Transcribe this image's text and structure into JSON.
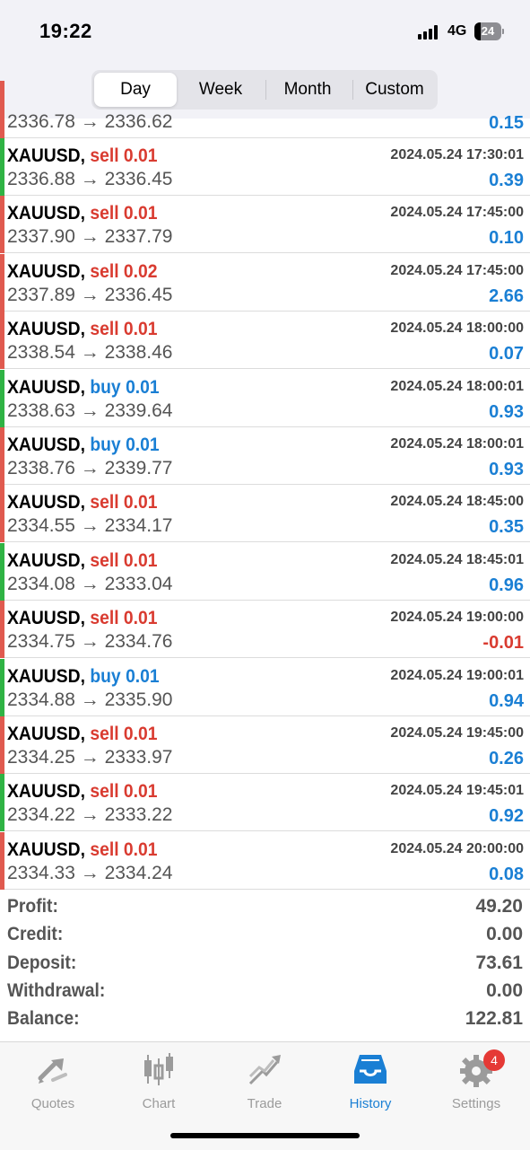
{
  "status_bar": {
    "time": "19:22",
    "network": "4G",
    "battery": "24"
  },
  "period_tabs": [
    {
      "label": "Day",
      "active": true
    },
    {
      "label": "Week",
      "active": false
    },
    {
      "label": "Month",
      "active": false
    },
    {
      "label": "Custom",
      "active": false
    }
  ],
  "colors": {
    "buy": "#1a7fd4",
    "sell": "#d93b30",
    "profit": "#1a7fd4",
    "loss": "#d93b30",
    "bar_green": "#2fb344",
    "bar_red": "#e05a4f"
  },
  "partial_row": {
    "prices": "2336.78 → 2336.62",
    "profit": "0.15"
  },
  "deals": [
    {
      "symbol": "XAUUSD,",
      "side": "sell",
      "lot": "0.01",
      "time": "2024.05.24 17:30:01",
      "prices": "2336.88 → 2336.45",
      "profit": "0.39",
      "bar": "green"
    },
    {
      "symbol": "XAUUSD,",
      "side": "sell",
      "lot": "0.01",
      "time": "2024.05.24 17:45:00",
      "prices": "2337.90 → 2337.79",
      "profit": "0.10",
      "bar": "red"
    },
    {
      "symbol": "XAUUSD,",
      "side": "sell",
      "lot": "0.02",
      "time": "2024.05.24 17:45:00",
      "prices": "2337.89 → 2336.45",
      "profit": "2.66",
      "bar": "red"
    },
    {
      "symbol": "XAUUSD,",
      "side": "sell",
      "lot": "0.01",
      "time": "2024.05.24 18:00:00",
      "prices": "2338.54 → 2338.46",
      "profit": "0.07",
      "bar": "red"
    },
    {
      "symbol": "XAUUSD,",
      "side": "buy",
      "lot": "0.01",
      "time": "2024.05.24 18:00:01",
      "prices": "2338.63 → 2339.64",
      "profit": "0.93",
      "bar": "green"
    },
    {
      "symbol": "XAUUSD,",
      "side": "buy",
      "lot": "0.01",
      "time": "2024.05.24 18:00:01",
      "prices": "2338.76 → 2339.77",
      "profit": "0.93",
      "bar": "red"
    },
    {
      "symbol": "XAUUSD,",
      "side": "sell",
      "lot": "0.01",
      "time": "2024.05.24 18:45:00",
      "prices": "2334.55 → 2334.17",
      "profit": "0.35",
      "bar": "red"
    },
    {
      "symbol": "XAUUSD,",
      "side": "sell",
      "lot": "0.01",
      "time": "2024.05.24 18:45:01",
      "prices": "2334.08 → 2333.04",
      "profit": "0.96",
      "bar": "green"
    },
    {
      "symbol": "XAUUSD,",
      "side": "sell",
      "lot": "0.01",
      "time": "2024.05.24 19:00:00",
      "prices": "2334.75 → 2334.76",
      "profit": "-0.01",
      "bar": "red"
    },
    {
      "symbol": "XAUUSD,",
      "side": "buy",
      "lot": "0.01",
      "time": "2024.05.24 19:00:01",
      "prices": "2334.88 → 2335.90",
      "profit": "0.94",
      "bar": "green"
    },
    {
      "symbol": "XAUUSD,",
      "side": "sell",
      "lot": "0.01",
      "time": "2024.05.24 19:45:00",
      "prices": "2334.25 → 2333.97",
      "profit": "0.26",
      "bar": "red"
    },
    {
      "symbol": "XAUUSD,",
      "side": "sell",
      "lot": "0.01",
      "time": "2024.05.24 19:45:01",
      "prices": "2334.22 → 2333.22",
      "profit": "0.92",
      "bar": "green"
    },
    {
      "symbol": "XAUUSD,",
      "side": "sell",
      "lot": "0.01",
      "time": "2024.05.24 20:00:00",
      "prices": "2334.33 → 2334.24",
      "profit": "0.08",
      "bar": "red"
    }
  ],
  "summary": [
    {
      "label": "Profit:",
      "value": "49.20"
    },
    {
      "label": "Credit:",
      "value": "0.00"
    },
    {
      "label": "Deposit:",
      "value": "73.61"
    },
    {
      "label": "Withdrawal:",
      "value": "0.00"
    },
    {
      "label": "Balance:",
      "value": "122.81"
    }
  ],
  "tab_bar": [
    {
      "label": "Quotes",
      "icon": "quotes-icon",
      "active": false
    },
    {
      "label": "Chart",
      "icon": "candlestick-chart-icon",
      "active": false
    },
    {
      "label": "Trade",
      "icon": "trade-trend-icon",
      "active": false
    },
    {
      "label": "History",
      "icon": "history-inbox-icon",
      "active": true
    },
    {
      "label": "Settings",
      "icon": "gear-icon",
      "active": false,
      "badge": "4"
    }
  ]
}
